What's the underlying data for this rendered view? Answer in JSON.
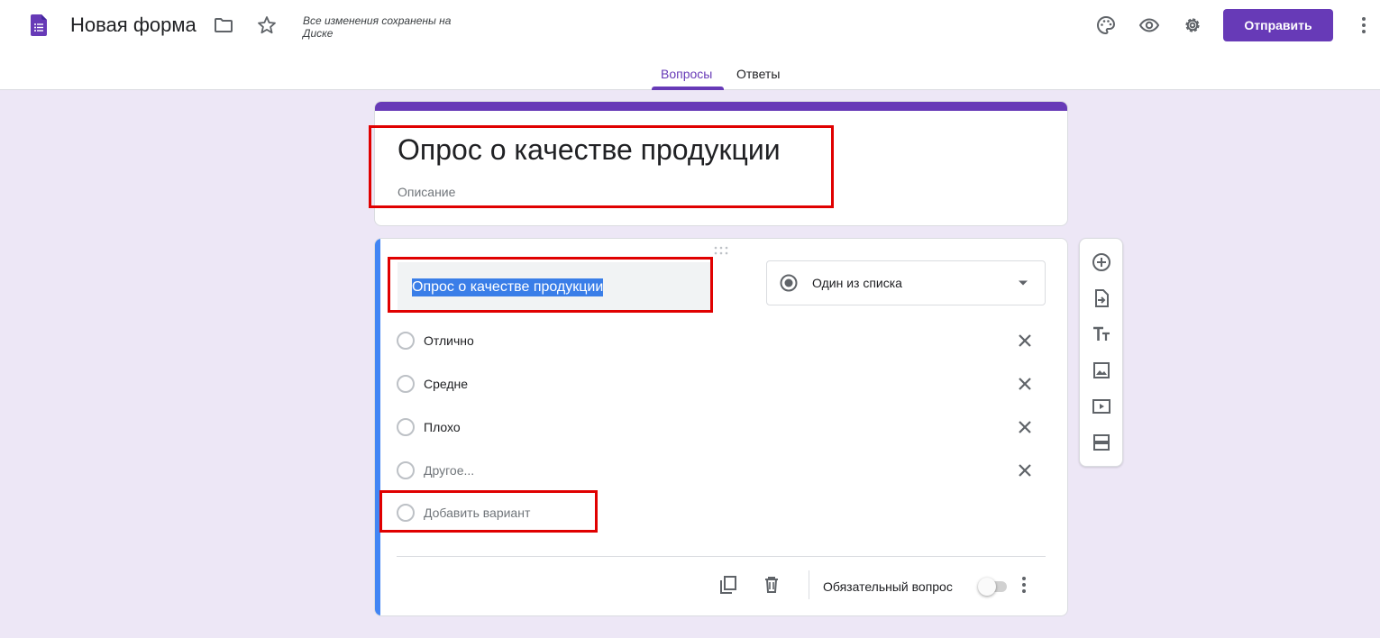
{
  "header": {
    "title": "Новая форма",
    "save_status": "Все изменения сохранены на Диске",
    "send_label": "Отправить",
    "accent_color": "#673ab7",
    "icons": [
      "forms-logo-icon",
      "folder-icon",
      "star-icon",
      "palette-icon",
      "eye-icon",
      "gear-icon",
      "more-vert-icon"
    ]
  },
  "tabs": [
    {
      "label": "Вопросы",
      "active": true
    },
    {
      "label": "Ответы",
      "active": false
    }
  ],
  "form": {
    "title": "Опрос о качестве продукции",
    "description_placeholder": "Описание"
  },
  "question": {
    "title": "Опрос о качестве продукции",
    "type_label": "Один из списка",
    "options": [
      {
        "label": "Отлично"
      },
      {
        "label": "Средне"
      },
      {
        "label": "Плохо"
      },
      {
        "label": "Другое..."
      }
    ],
    "add_option_label": "Добавить вариант",
    "required_label": "Обязательный вопрос",
    "required": false
  },
  "side_toolbar": [
    "add-question-icon",
    "import-questions-icon",
    "add-title-icon",
    "add-image-icon",
    "add-video-icon",
    "add-section-icon"
  ],
  "colors": {
    "highlight_box": "#e00000",
    "question_accent": "#4285f4",
    "background": "#ede7f6"
  }
}
